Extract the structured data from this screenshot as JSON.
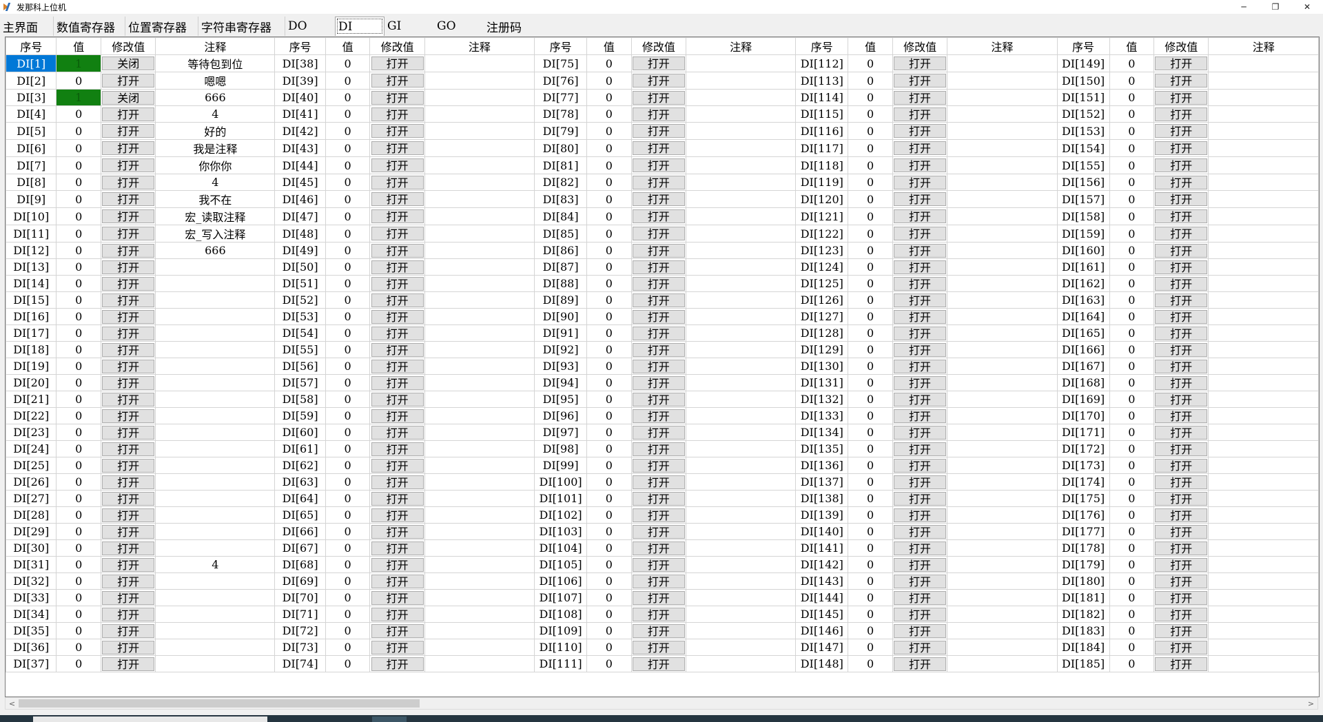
{
  "window": {
    "title": "发那科上位机",
    "controls": [
      "─",
      "❐",
      "✕"
    ]
  },
  "tabs": [
    {
      "label": "主界面",
      "active": false
    },
    {
      "label": "数值寄存器",
      "active": false
    },
    {
      "label": "位置寄存器",
      "active": false
    },
    {
      "label": "字符串寄存器",
      "active": false
    },
    {
      "label": "DO",
      "active": false
    },
    {
      "label": "DI",
      "active": true
    },
    {
      "label": "GI",
      "active": false
    },
    {
      "label": "GO",
      "active": false
    },
    {
      "label": "注册码",
      "active": false
    }
  ],
  "table": {
    "headers": [
      "序号",
      "值",
      "修改值",
      "注释"
    ],
    "prefix": "DI",
    "rows_per_block": 37,
    "start_indices": [
      1,
      38,
      75,
      112,
      149
    ],
    "selected_index": 1,
    "button_labels": {
      "on": "关闭",
      "off": "打开"
    },
    "on_values": {
      "1": "1",
      "3": "1"
    },
    "default_value": "0",
    "comments": {
      "1": "等待包到位",
      "2": "嗯嗯",
      "3": "666",
      "4": "4",
      "5": "好的",
      "6": "我是注释",
      "7": "你你你",
      "8": "4",
      "9": "我不在",
      "10": "宏_读取注释",
      "11": "宏_写入注释",
      "12": "666",
      "31": "4"
    }
  },
  "scrollbar": {
    "left_arrow": "<",
    "right_arrow": ">"
  },
  "colors": {
    "on_value_bg": "#118011",
    "selected_bg": "#0078d7"
  }
}
